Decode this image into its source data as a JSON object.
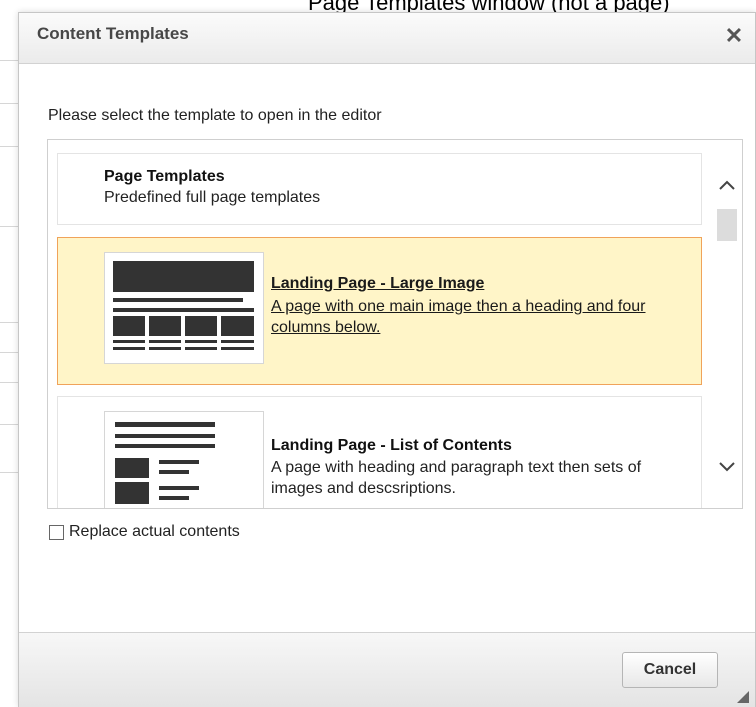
{
  "background": {
    "caption": "Page Templates window (not a page)"
  },
  "dialog": {
    "title": "Content Templates",
    "close_symbol": "✕",
    "prompt": "Please select the template to open in the editor",
    "group": {
      "title": "Page Templates",
      "description": "Predefined full page templates"
    },
    "templates": [
      {
        "name": "Landing Page - Large Image",
        "description": "A page with one main image then a heading and four columns below.",
        "selected": true,
        "thumbnail_icon": "large-image-layout-icon"
      },
      {
        "name": "Landing Page - List of Contents",
        "description": "A page with heading and paragraph text then sets of images and descsriptions.",
        "selected": false,
        "thumbnail_icon": "list-of-contents-layout-icon"
      }
    ],
    "replace_label": "Replace actual contents",
    "replace_checked": false,
    "cancel_label": "Cancel"
  },
  "colors": {
    "selected_bg": "#fff5c8",
    "selected_border": "#f0a35a",
    "title_text": "#474747"
  }
}
